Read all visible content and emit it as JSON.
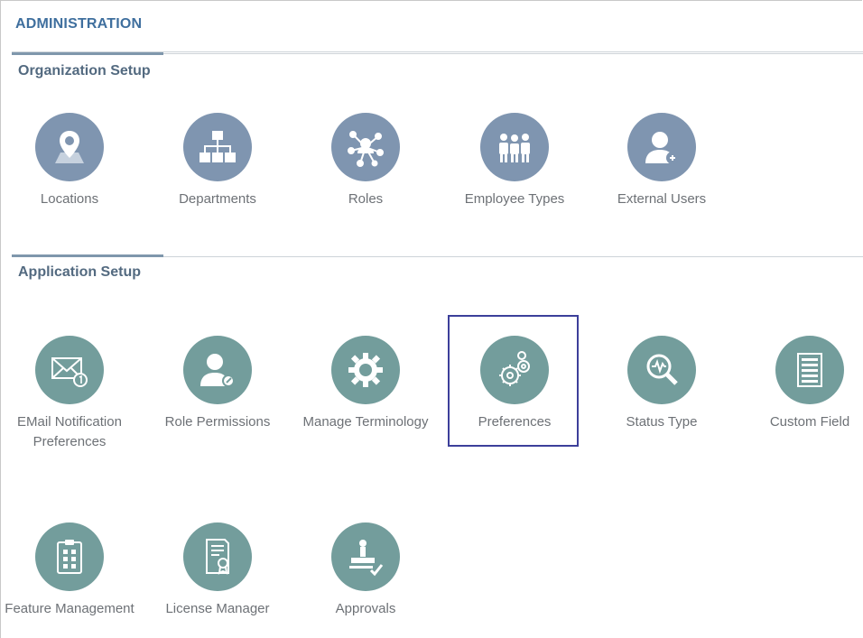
{
  "page": {
    "title": "ADMINISTRATION"
  },
  "sections": {
    "org": {
      "title": "Organization Setup",
      "items": [
        {
          "label": "Locations",
          "icon": "location-pin-icon"
        },
        {
          "label": "Departments",
          "icon": "org-chart-icon"
        },
        {
          "label": "Roles",
          "icon": "network-roles-icon"
        },
        {
          "label": "Employee Types",
          "icon": "employee-group-icon"
        },
        {
          "label": "External Users",
          "icon": "external-user-icon"
        }
      ]
    },
    "app": {
      "title": "Application Setup",
      "items": [
        {
          "label": "EMail Notification Preferences",
          "icon": "email-notification-icon"
        },
        {
          "label": "Role Permissions",
          "icon": "user-key-icon"
        },
        {
          "label": "Manage Terminology",
          "icon": "terminology-gear-icon"
        },
        {
          "label": "Preferences",
          "icon": "gears-icon",
          "selected": true
        },
        {
          "label": "Status Type",
          "icon": "status-magnifier-icon"
        },
        {
          "label": "Custom Field",
          "icon": "list-form-icon"
        },
        {
          "label": "Feature Management",
          "icon": "clipboard-feature-icon"
        },
        {
          "label": "License Manager",
          "icon": "license-certificate-icon"
        },
        {
          "label": "Approvals",
          "icon": "approval-stamp-icon"
        }
      ]
    }
  },
  "colors": {
    "title": "#3f6f9e",
    "org_icon_bg": "#7f95b0",
    "app_icon_bg": "#739d9c",
    "selection": "#3c3f9a"
  }
}
